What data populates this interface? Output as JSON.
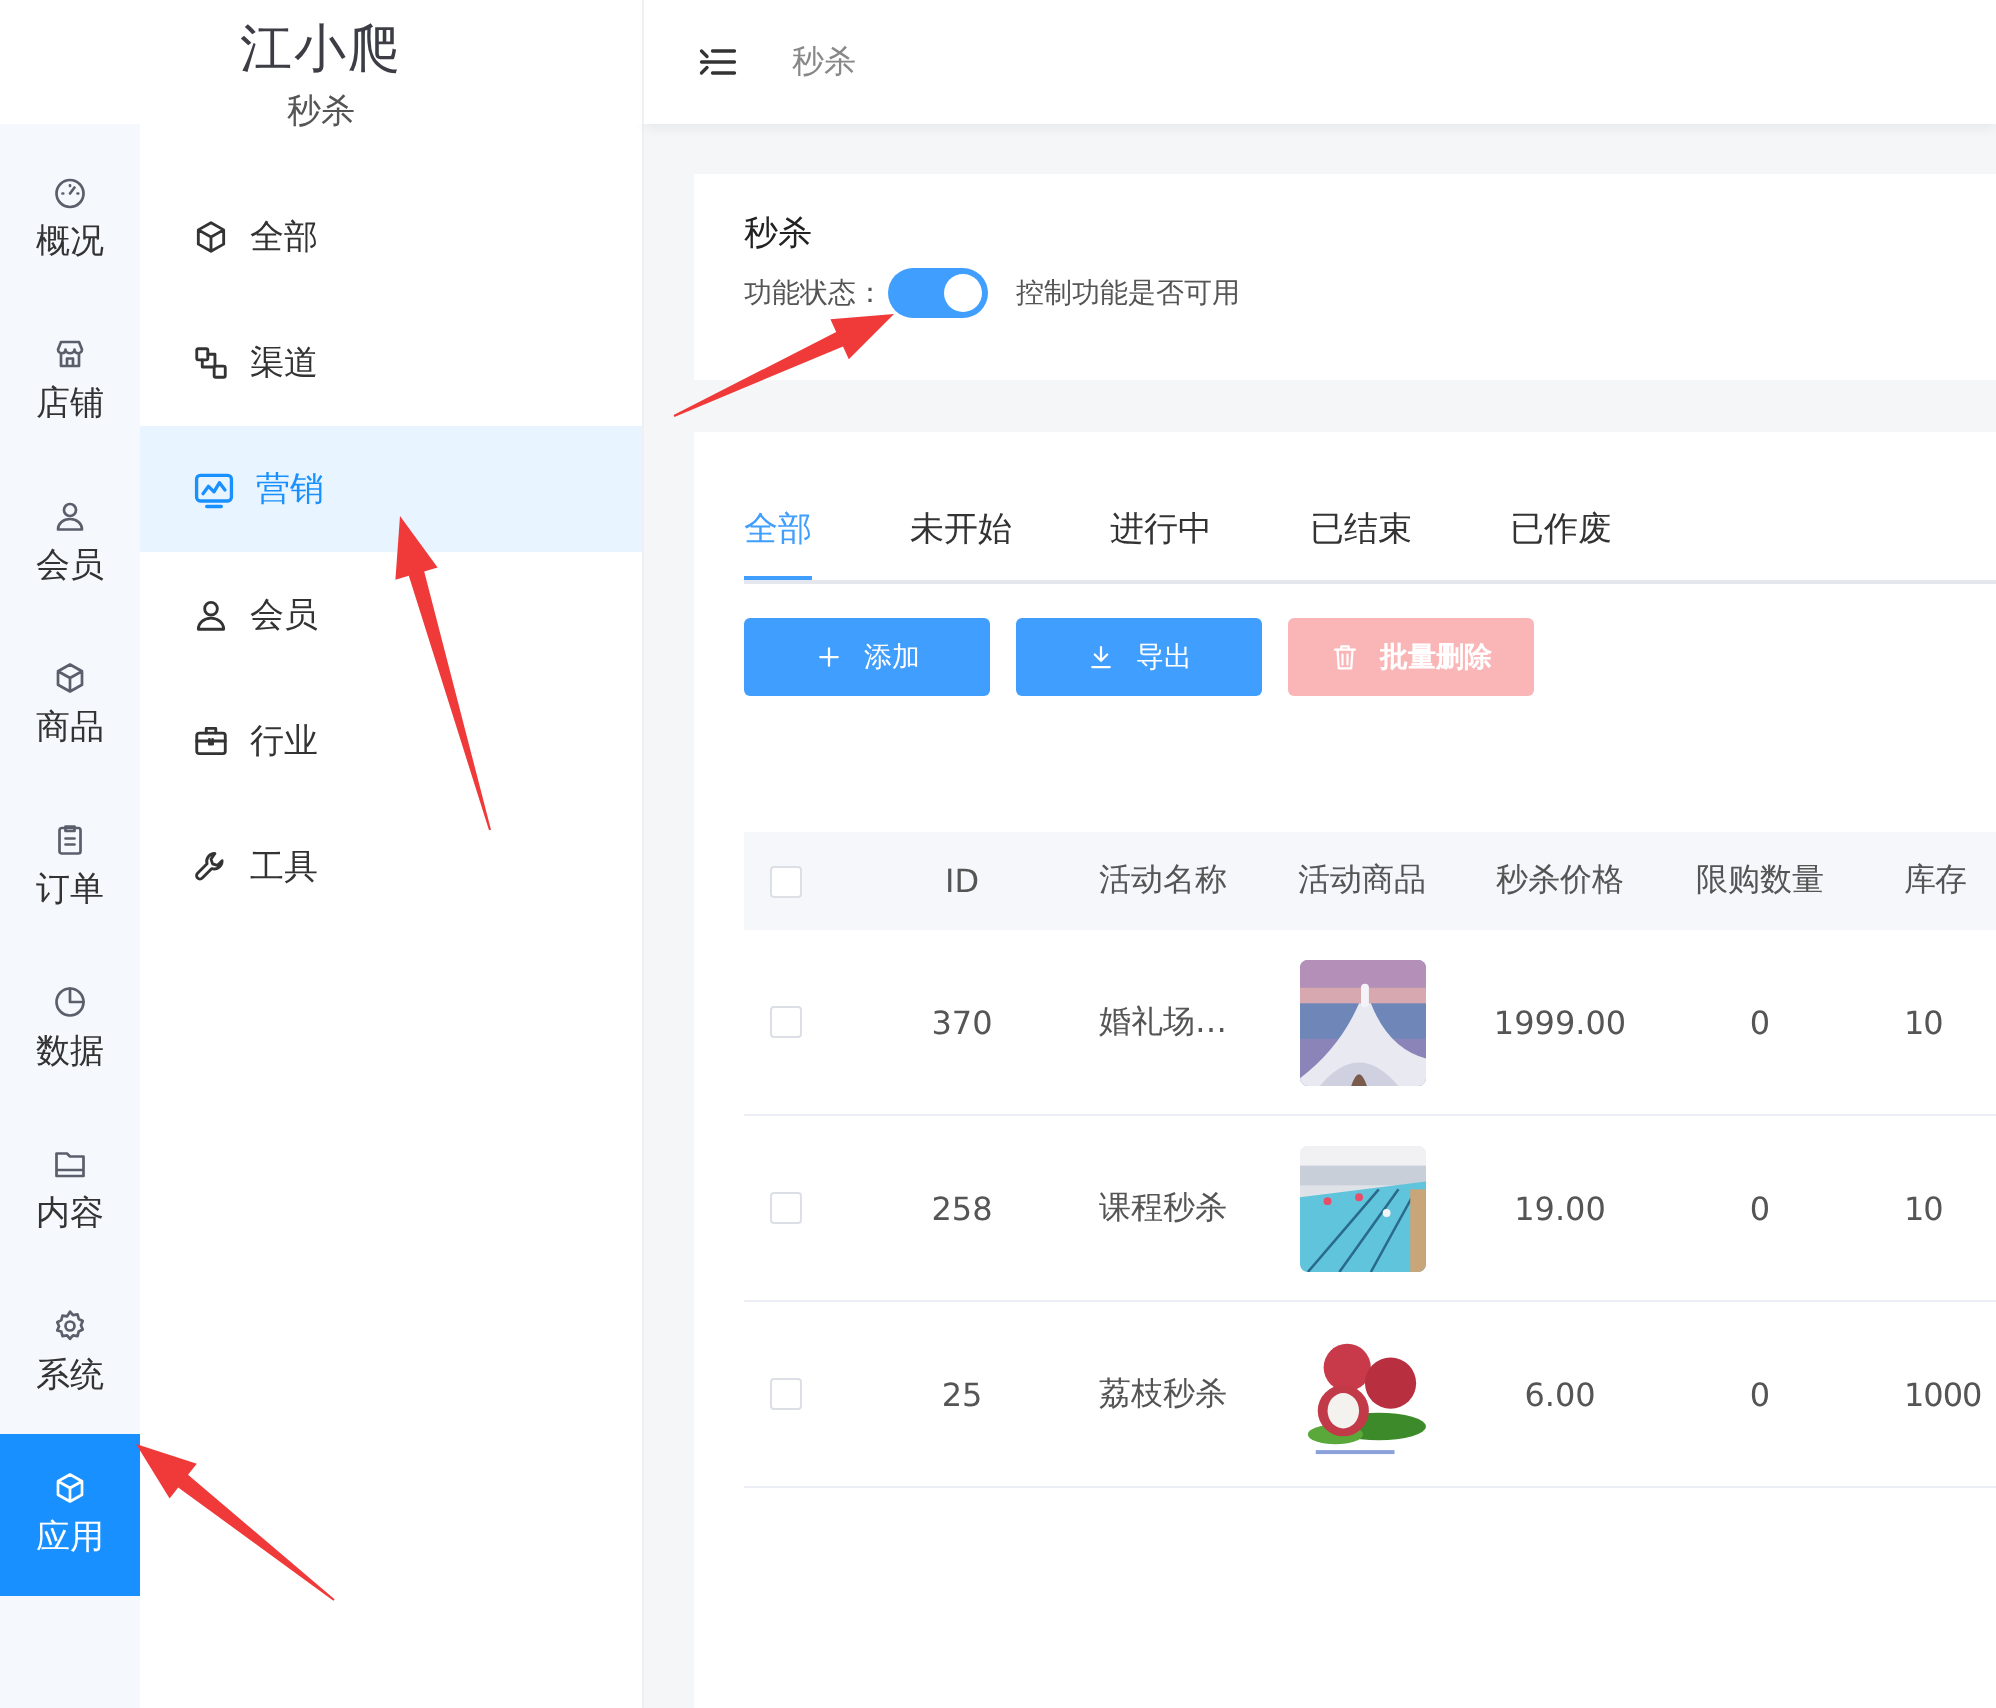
{
  "brand": {
    "title": "江小爬",
    "subtitle": "秒杀"
  },
  "header": {
    "breadcrumb": "秒杀"
  },
  "rail": [
    {
      "label": "概况",
      "selected": false
    },
    {
      "label": "店铺",
      "selected": false
    },
    {
      "label": "会员",
      "selected": false
    },
    {
      "label": "商品",
      "selected": false
    },
    {
      "label": "订单",
      "selected": false
    },
    {
      "label": "数据",
      "selected": false
    },
    {
      "label": "内容",
      "selected": false
    },
    {
      "label": "系统",
      "selected": false
    },
    {
      "label": "应用",
      "selected": true
    }
  ],
  "submenu": [
    {
      "label": "全部",
      "selected": false
    },
    {
      "label": "渠道",
      "selected": false
    },
    {
      "label": "营销",
      "selected": true
    },
    {
      "label": "会员",
      "selected": false
    },
    {
      "label": "行业",
      "selected": false
    },
    {
      "label": "工具",
      "selected": false
    }
  ],
  "feature": {
    "title": "秒杀",
    "label": "功能状态：",
    "on": true,
    "hint": "控制功能是否可用"
  },
  "tabs": [
    {
      "label": "全部",
      "selected": true
    },
    {
      "label": "未开始",
      "selected": false
    },
    {
      "label": "进行中",
      "selected": false
    },
    {
      "label": "已结束",
      "selected": false
    },
    {
      "label": "已作废",
      "selected": false
    }
  ],
  "buttons": [
    {
      "label": "添加",
      "disabled": false
    },
    {
      "label": "导出",
      "disabled": false
    },
    {
      "label": "批量删除",
      "disabled": true
    }
  ],
  "table": {
    "all_checked": false,
    "columns": [
      "ID",
      "活动名称",
      "活动商品",
      "秒杀价格",
      "限购数量",
      "库存"
    ],
    "rows": [
      {
        "checked": false,
        "id": "370",
        "name": "婚礼场…",
        "price": "1999.00",
        "limit": "0",
        "stock": "10"
      },
      {
        "checked": false,
        "id": "258",
        "name": "课程秒杀",
        "price": "19.00",
        "limit": "0",
        "stock": "10"
      },
      {
        "checked": false,
        "id": "25",
        "name": "荔枝秒杀",
        "price": "6.00",
        "limit": "0",
        "stock": "1000"
      }
    ]
  }
}
